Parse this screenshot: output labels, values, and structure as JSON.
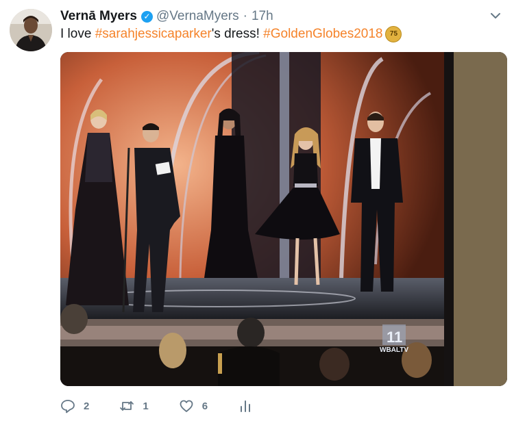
{
  "tweet": {
    "author_name": "Vernā Myers",
    "handle": "@VernaMyers",
    "separator": "·",
    "time": "17h",
    "text_prefix": "I love ",
    "hashtag1": "#sarahjessicaparker",
    "text_middle": "'s dress! ",
    "hashtag2": "#GoldenGlobes2018",
    "badge_text": "75"
  },
  "media": {
    "watermark_text": "WBALTV",
    "watermark_number": "11"
  },
  "actions": {
    "reply_count": "2",
    "retweet_count": "1",
    "like_count": "6"
  },
  "colors": {
    "hashtag": "#f5832a",
    "verified": "#1da1f2",
    "meta_gray": "#657786"
  }
}
